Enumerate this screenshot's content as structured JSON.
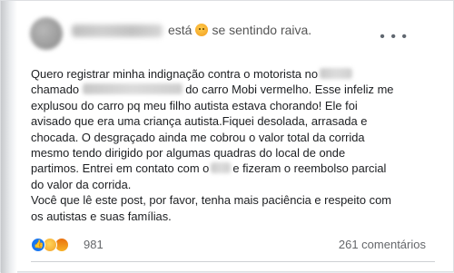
{
  "post": {
    "author_blurred": true,
    "feeling_prefix": "está",
    "feeling_emoji": "sad-face",
    "feeling_text": "se sentindo raiva.",
    "body": {
      "line1": "Quero registrar minha indignação contra o motorista no",
      "line2_a": "chamado",
      "line2_b": "do carro Mobi vermelho. Esse infeliz me",
      "line3": "explusou do carro pq meu filho autista estava chorando! Ele foi",
      "line4": "avisado que era uma criança autista.Fiquei desolada, arrasada e",
      "line5": "chocada. O desgraçado ainda me cobrou o valor total da corrida",
      "line6": "mesmo tendo dirigido por algumas quadras do local de onde",
      "line7": "partimos. Entrei em contato com o",
      "line7_b": "e fizeram o reembolso parcial",
      "line8": "do valor da corrida.",
      "line9": "Você que lê este post, por favor, tenha mais paciência e respeito com",
      "line10": "os autistas e suas famílias."
    },
    "reactions_count": "981",
    "comments_count": "261 comentários"
  }
}
